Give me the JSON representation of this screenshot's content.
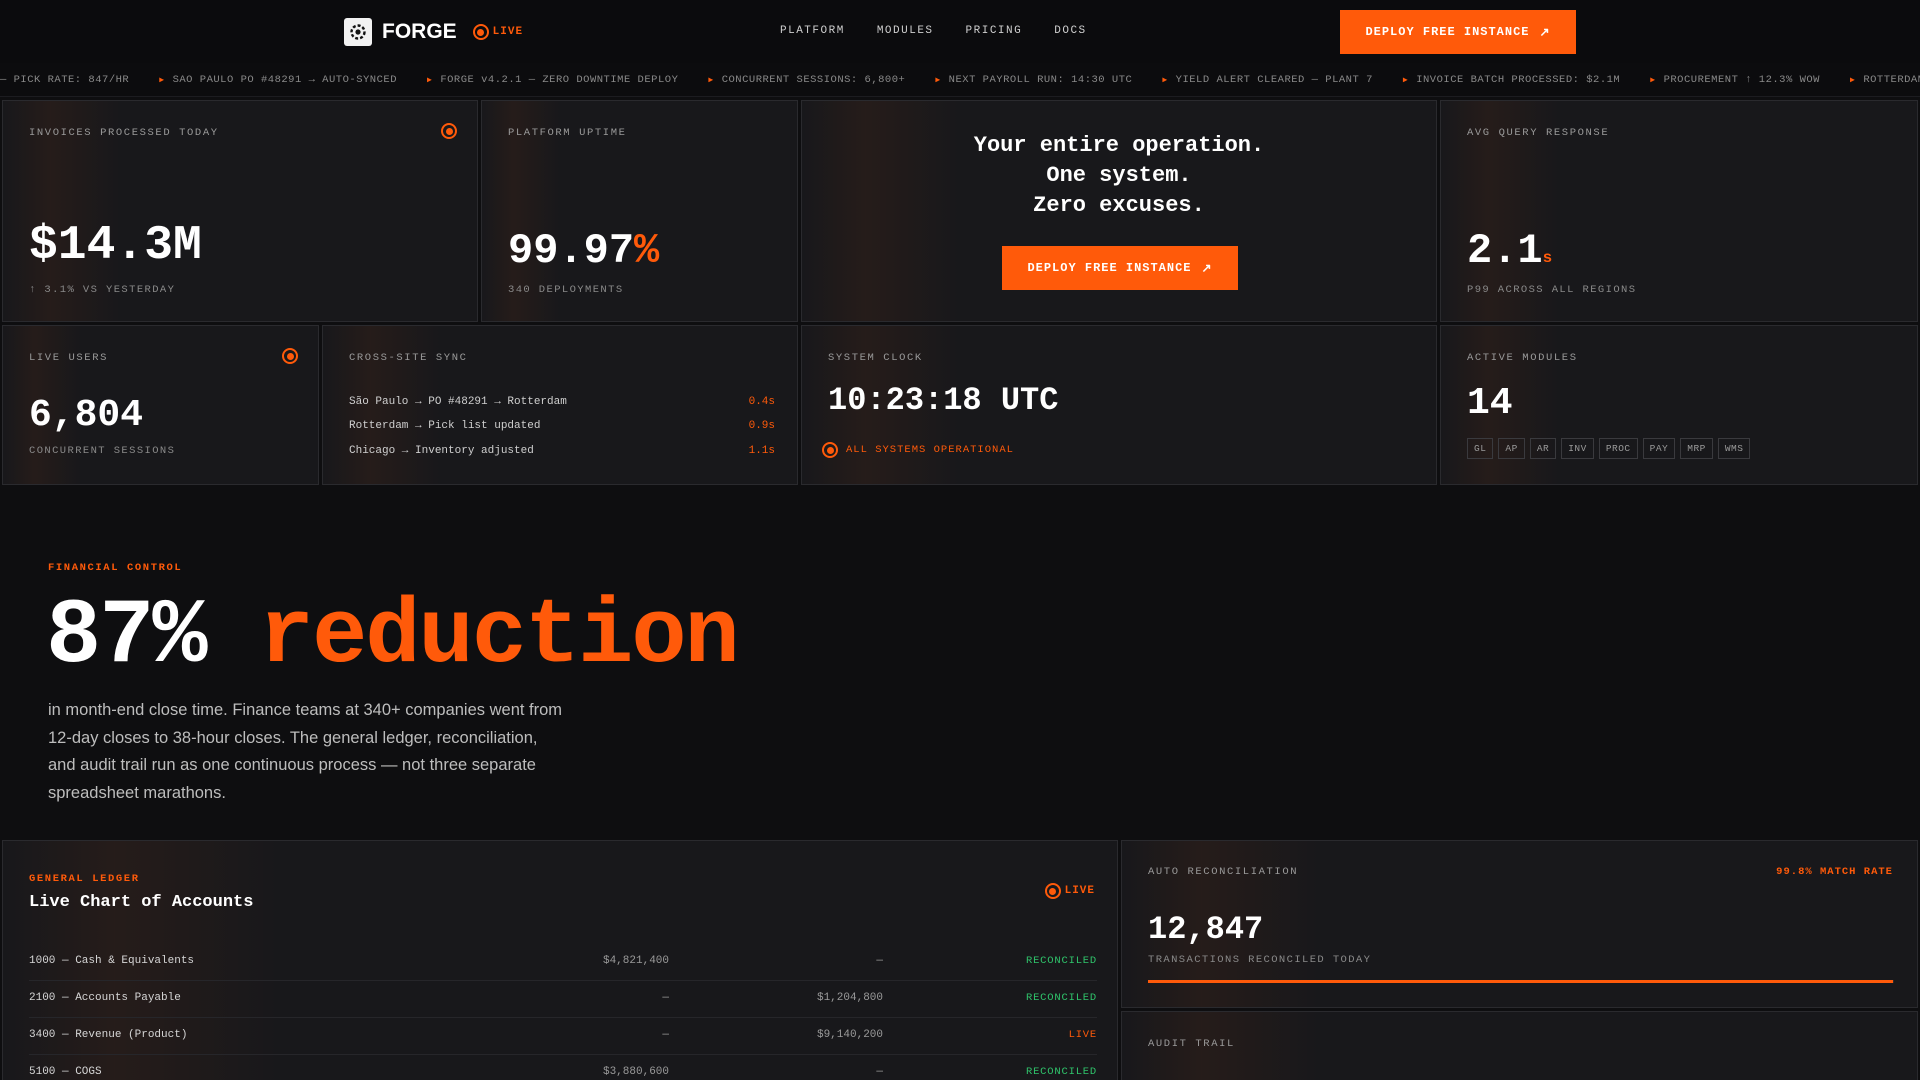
{
  "nav": {
    "brand": "FORGE",
    "live_label": "LIVE",
    "links": [
      "PLATFORM",
      "MODULES",
      "PRICING",
      "DOCS"
    ],
    "cta": "DEPLOY FREE INSTANCE"
  },
  "ticker": [
    "— PICK RATE: 847/HR",
    "SAO PAULO PO #48291 → AUTO-SYNCED",
    "FORGE v4.2.1 — ZERO DOWNTIME DEPLOY",
    "CONCURRENT SESSIONS: 6,800+",
    "NEXT PAYROLL RUN: 14:30 UTC",
    "YIELD ALERT CLEARED — PLANT 7",
    "INVOICE BATCH PROCESSED: $2.1M",
    "PROCUREMENT ↑ 12.3% WOW",
    "ROTTERDAM WA"
  ],
  "cards": {
    "invoices": {
      "label": "INVOICES PROCESSED TODAY",
      "value": "$14.3M",
      "sub": "↑ 3.1% VS YESTERDAY"
    },
    "uptime": {
      "label": "PLATFORM UPTIME",
      "value": "99.97",
      "unit": "%",
      "sub": "340 DEPLOYMENTS"
    },
    "hero": {
      "line1": "Your entire operation.",
      "line2": "One system.",
      "line3": "Zero excuses.",
      "cta": "DEPLOY FREE INSTANCE"
    },
    "query": {
      "label": "AVG QUERY RESPONSE",
      "value": "2.1",
      "unit": "s",
      "sub": "P99 ACROSS ALL REGIONS"
    },
    "users": {
      "label": "LIVE USERS",
      "value": "6,804",
      "sub": "CONCURRENT SESSIONS"
    },
    "sync": {
      "label": "CROSS-SITE SYNC",
      "rows": [
        {
          "text": "São Paulo → PO #48291 → Rotterdam",
          "time": "0.4s"
        },
        {
          "text": "Rotterdam → Pick list updated",
          "time": "0.9s"
        },
        {
          "text": "Chicago → Inventory adjusted",
          "time": "1.1s"
        }
      ]
    },
    "clock": {
      "label": "SYSTEM CLOCK",
      "value": "10:23:18 UTC",
      "status": "ALL SYSTEMS OPERATIONAL"
    },
    "modules": {
      "label": "ACTIVE MODULES",
      "value": "14",
      "chips": [
        "GL",
        "AP",
        "AR",
        "INV",
        "PROC",
        "PAY",
        "MRP",
        "WMS"
      ]
    }
  },
  "financial": {
    "eyebrow": "FINANCIAL CONTROL",
    "headline_num": "87%",
    "headline_word": "reduction",
    "body": "in month-end close time. Finance teams at 340+ companies went from 12-day closes to 38-hour closes. The general ledger, reconciliation, and audit trail run as one continuous process — not three separate spreadsheet marathons."
  },
  "ledger": {
    "eyebrow": "GENERAL LEDGER",
    "title": "Live Chart of Accounts",
    "live_label": "LIVE",
    "rows": [
      {
        "account": "1000 — Cash & Equivalents",
        "debit": "$4,821,400",
        "credit": "—",
        "status": "RECONCILED"
      },
      {
        "account": "2100 — Accounts Payable",
        "debit": "—",
        "credit": "$1,204,800",
        "status": "RECONCILED"
      },
      {
        "account": "3400 — Revenue (Product)",
        "debit": "—",
        "credit": "$9,140,200",
        "status": "LIVE"
      },
      {
        "account": "5100 — COGS",
        "debit": "$3,880,600",
        "credit": "—",
        "status": "RECONCILED"
      }
    ]
  },
  "recon": {
    "label": "AUTO RECONCILIATION",
    "rate": "99.8% MATCH RATE",
    "rate_fraction": 0.998,
    "value": "12,847",
    "sub": "TRANSACTIONS RECONCILED TODAY"
  },
  "audit": {
    "label": "AUDIT TRAIL"
  }
}
